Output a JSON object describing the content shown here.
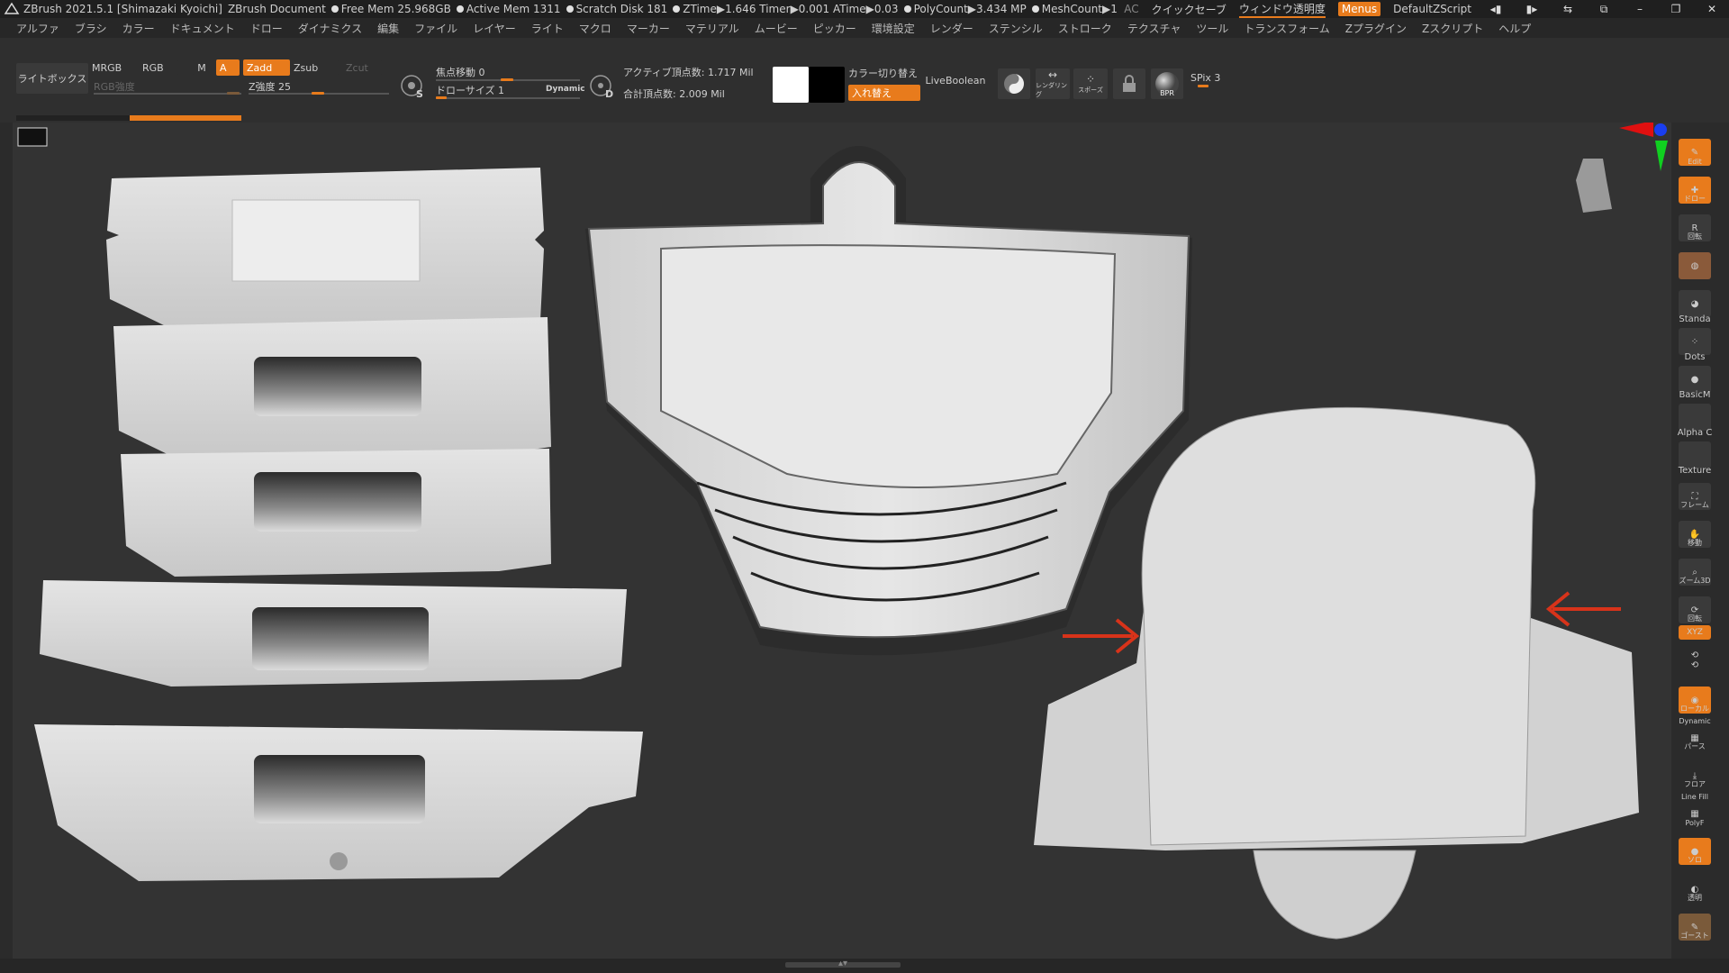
{
  "titlebar": {
    "app": "ZBrush 2021.5.1 [Shimazaki Kyoichi]",
    "document": "ZBrush Document",
    "stats": [
      "Free Mem 25.968GB",
      "Active Mem 1311",
      "Scratch Disk 181",
      "ZTime▶1.646 Timer▶0.001 ATime▶0.03",
      "PolyCount▶3.434 MP",
      "MeshCount▶1"
    ],
    "ac": "AC",
    "quicksave": "クイックセーブ",
    "transparency": "ウィンドウ透明度",
    "menus": "Menus",
    "script": "DefaultZScript"
  },
  "menubar": [
    "アルファ",
    "ブラシ",
    "カラー",
    "ドキュメント",
    "ドロー",
    "ダイナミクス",
    "編集",
    "ファイル",
    "レイヤー",
    "ライト",
    "マクロ",
    "マーカー",
    "マテリアル",
    "ムービー",
    "ピッカー",
    "環境設定",
    "レンダー",
    "ステンシル",
    "ストローク",
    "テクスチャ",
    "ツール",
    "トランスフォーム",
    "Zプラグイン",
    "Zスクリプト",
    "ヘルプ"
  ],
  "toolbar": {
    "lightbox": "ライトボックス",
    "mrgb": "MRGB",
    "rgb": "RGB",
    "m": "M",
    "a": "A",
    "zadd": "Zadd",
    "zsub": "Zsub",
    "zcut": "Zcut",
    "rgb_intensity": "RGB強度",
    "z_intensity": "Z強度 25",
    "focal_shift": "焦点移動 0",
    "draw_size": "ドローサイズ 1",
    "dynamic": "Dynamic",
    "active_points": "アクティブ頂点数: 1.717 Mil",
    "total_points": "合計頂点数: 2.009 Mil",
    "switch_color": "カラー切り替え",
    "swap": "入れ替え",
    "liveboolean": "LiveBoolean",
    "spix": "SPix 3",
    "s_label": "S",
    "d_label": "D",
    "render_label": "レンダリング",
    "stroke_label": "スポーズ",
    "bpr": "BPR",
    "colors": {
      "main": "#ffffff",
      "secondary": "#000000",
      "accent": "#e87b1c"
    }
  },
  "shelf": {
    "edit": "Edit",
    "draw": "ドロー",
    "rotate_r": "回転",
    "standard": "Standa",
    "dots": "Dots",
    "basic": "BasicM",
    "alpha": "Alpha C",
    "texture": "Texture",
    "frame": "フレーム",
    "move": "移動",
    "zoom": "ズーム3D",
    "rotate": "回転",
    "xyz": "XYZ",
    "local": "ローカル",
    "dynamic": "Dynamic",
    "perspective": "パース",
    "floor": "フロア",
    "line_fill": "Line Fill",
    "polyf": "PolyF",
    "solo": "ソロ",
    "transparent": "透明",
    "ghost": "ゴースト"
  }
}
